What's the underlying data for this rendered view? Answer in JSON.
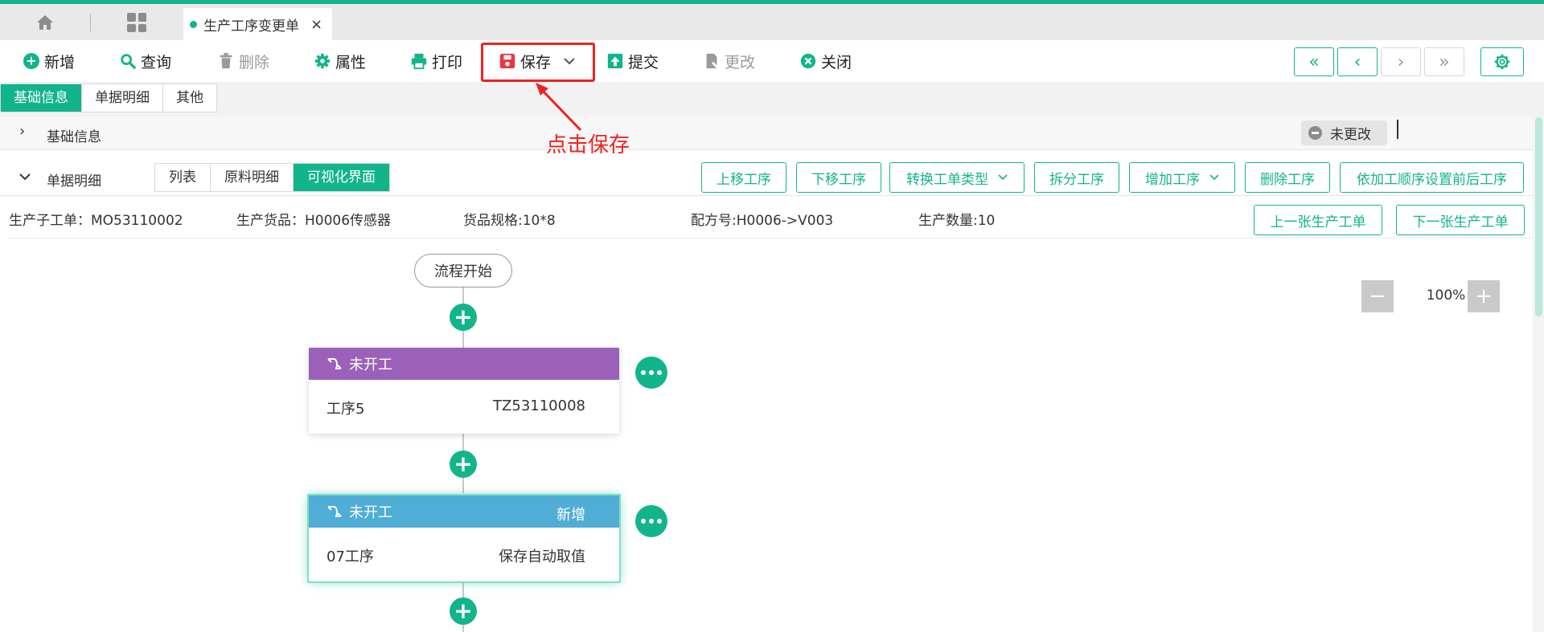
{
  "tab": {
    "title": "生产工序变更单",
    "close": "×"
  },
  "toolbar": {
    "add": "新增",
    "query": "查询",
    "delete": "删除",
    "props": "属性",
    "print": "打印",
    "save": "保存",
    "submit": "提交",
    "modify": "更改",
    "close": "关闭",
    "nav": [
      "«",
      "‹",
      "›",
      "»"
    ]
  },
  "section_tabs": [
    "基础信息",
    "单据明细",
    "其他"
  ],
  "basic_row": {
    "label": "基础信息",
    "status": "未更改"
  },
  "detail_row": {
    "label": "单据明细",
    "views": [
      "列表",
      "原料明细",
      "可视化界面"
    ],
    "actions": [
      "上移工序",
      "下移工序",
      "转换工单类型",
      "拆分工序",
      "增加工序",
      "删除工序",
      "依加工顺序设置前后工序"
    ]
  },
  "info": {
    "sub_order": "生产子工单：MO53110002",
    "product": "生产货品：H0006传感器",
    "spec": "货品规格:10*8",
    "recipe": "配方号:H0006->V003",
    "qty": "生产数量:10",
    "prev_order": "上一张生产工单",
    "next_order": "下一张生产工单"
  },
  "zoom": {
    "value": "100%",
    "minus": "−",
    "plus": "+"
  },
  "flow": {
    "start": "流程开始",
    "cards": [
      {
        "status": "未开工",
        "tag": "",
        "name": "工序5",
        "code": "TZ53110008",
        "color": "#9b61b8"
      },
      {
        "status": "未开工",
        "tag": "新增",
        "name": "07工序",
        "code": "保存自动取值",
        "color": "#4fadd6"
      }
    ]
  },
  "annotation": "点击保存",
  "colors": {
    "accent": "#12b48b",
    "annotation": "#ee2222"
  }
}
